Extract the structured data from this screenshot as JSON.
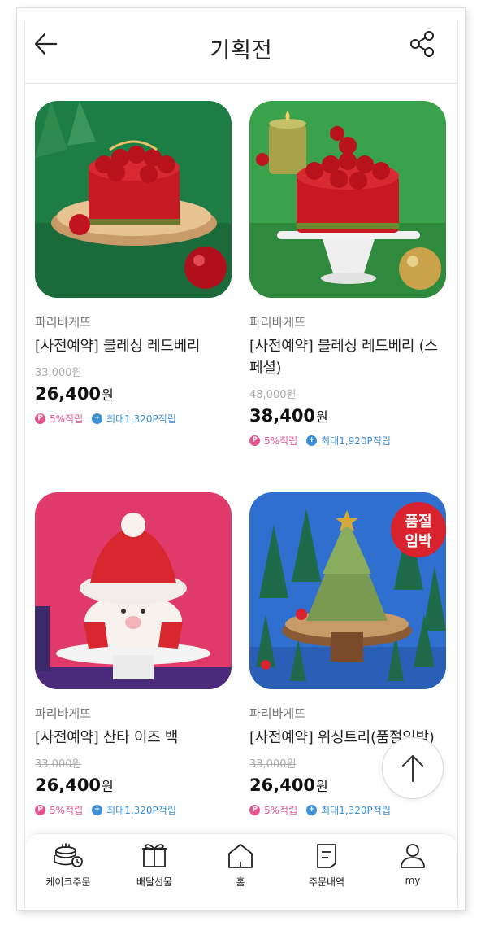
{
  "header": {
    "title": "기획전",
    "back_icon": "arrow-left-icon",
    "share_icon": "share-icon"
  },
  "products": [
    {
      "brand": "파리바게뜨",
      "name": "[사전예약] 블레싱 레드베리",
      "original_price": "33,000원",
      "price": "26,400",
      "currency": "원",
      "point_badge": "P",
      "point_rate": "5%적립",
      "max_badge": "+",
      "max_point": "최대1,320P적립"
    },
    {
      "brand": "파리바게뜨",
      "name": "[사전예약] 블레싱 레드베리 (스페셜)",
      "original_price": "48,000원",
      "price": "38,400",
      "currency": "원",
      "point_badge": "P",
      "point_rate": "5%적립",
      "max_badge": "+",
      "max_point": "최대1,920P적립"
    },
    {
      "brand": "파리바게뜨",
      "name": "[사전예약] 산타 이즈 백",
      "original_price": "33,000원",
      "price": "26,400",
      "currency": "원",
      "point_badge": "P",
      "point_rate": "5%적립",
      "max_badge": "+",
      "max_point": "최대1,320P적립"
    },
    {
      "brand": "파리바게뜨",
      "name": "[사전예약] 위싱트리(품절임박)",
      "original_price": "33,000원",
      "price": "26,400",
      "currency": "원",
      "point_badge": "P",
      "point_rate": "5%적립",
      "max_badge": "+",
      "max_point": "최대1,320P적립",
      "badge_line1": "품절",
      "badge_line2": "임박"
    }
  ],
  "scroll_top_icon": "arrow-up-icon",
  "bottom_nav": [
    {
      "label": "케이크주문",
      "icon": "cake-order-icon"
    },
    {
      "label": "배달선물",
      "icon": "gift-icon"
    },
    {
      "label": "홈",
      "icon": "home-icon"
    },
    {
      "label": "주문내역",
      "icon": "order-history-icon"
    },
    {
      "label": "my",
      "icon": "user-icon"
    }
  ],
  "colors": {
    "point_pink": "#e8548f",
    "point_blue": "#3b8fd9"
  }
}
